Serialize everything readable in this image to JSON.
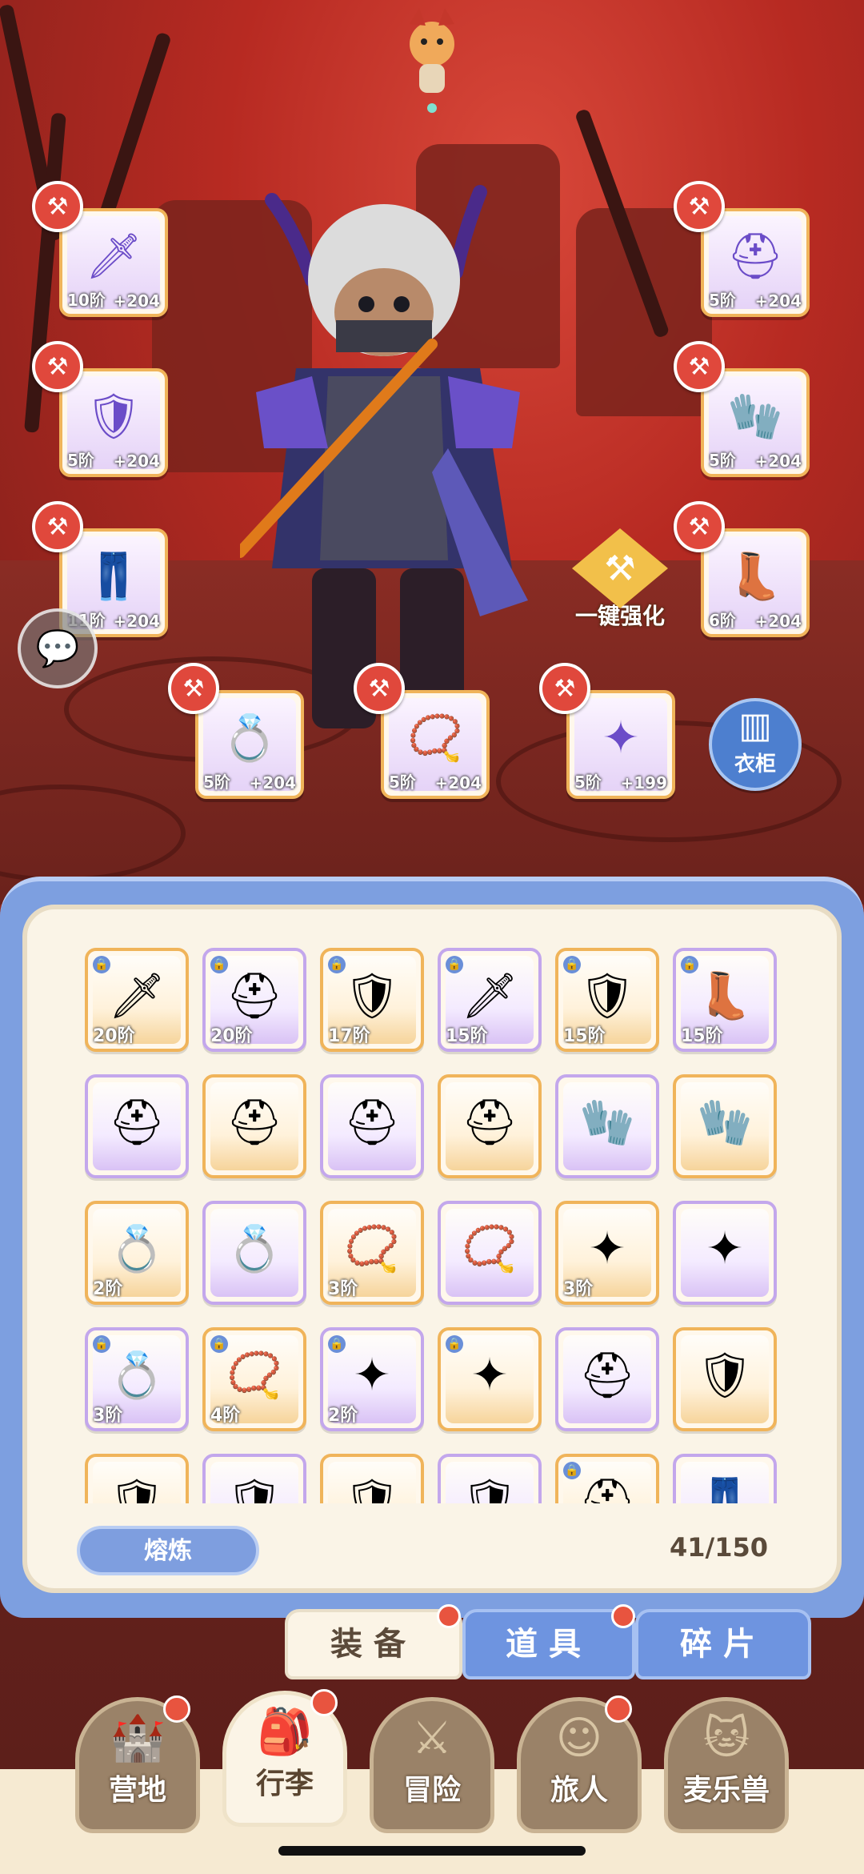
{
  "equipped": {
    "weapon": {
      "tier": "10阶",
      "bonus": "+204",
      "icon": "sword-icon"
    },
    "helmet": {
      "tier": "5阶",
      "bonus": "+204",
      "icon": "helmet-icon"
    },
    "armor": {
      "tier": "5阶",
      "bonus": "+204",
      "icon": "armor-icon"
    },
    "gloves": {
      "tier": "5阶",
      "bonus": "+204",
      "icon": "gloves-icon"
    },
    "pants": {
      "tier": "11阶",
      "bonus": "+204",
      "icon": "pants-icon"
    },
    "boots": {
      "tier": "6阶",
      "bonus": "+204",
      "icon": "boots-icon"
    },
    "ring": {
      "tier": "5阶",
      "bonus": "+204",
      "icon": "ring-icon"
    },
    "necklace": {
      "tier": "5阶",
      "bonus": "+204",
      "icon": "necklace-icon"
    },
    "charm": {
      "tier": "5阶",
      "bonus": "+199",
      "icon": "charm-icon"
    }
  },
  "actions": {
    "one_key_enhance": "一键强化",
    "wardrobe": "衣柜"
  },
  "inventory": {
    "rows": [
      [
        {
          "tier": "20阶",
          "icon": "sword-icon",
          "locked": true
        },
        {
          "tier": "20阶",
          "icon": "helmet-icon",
          "locked": true
        },
        {
          "tier": "17阶",
          "icon": "armor-icon",
          "locked": true
        },
        {
          "tier": "15阶",
          "icon": "sword-icon",
          "locked": true
        },
        {
          "tier": "15阶",
          "icon": "armor-icon",
          "locked": true
        },
        {
          "tier": "15阶",
          "icon": "boots-icon",
          "locked": true
        }
      ],
      [
        {
          "tier": "",
          "icon": "helmet-icon",
          "locked": false
        },
        {
          "tier": "",
          "icon": "helmet-icon",
          "locked": false
        },
        {
          "tier": "",
          "icon": "helmet-icon",
          "locked": false
        },
        {
          "tier": "",
          "icon": "helmet-icon",
          "locked": false
        },
        {
          "tier": "",
          "icon": "gloves-icon",
          "locked": false
        },
        {
          "tier": "",
          "icon": "gloves-icon",
          "locked": false
        }
      ],
      [
        {
          "tier": "2阶",
          "icon": "ring-icon",
          "locked": false
        },
        {
          "tier": "",
          "icon": "ring-icon",
          "locked": false
        },
        {
          "tier": "3阶",
          "icon": "necklace-icon",
          "locked": false
        },
        {
          "tier": "",
          "icon": "necklace-icon",
          "locked": false
        },
        {
          "tier": "3阶",
          "icon": "charm-icon",
          "locked": false
        },
        {
          "tier": "",
          "icon": "charm-icon",
          "locked": false
        }
      ],
      [
        {
          "tier": "3阶",
          "icon": "ring-icon",
          "locked": true
        },
        {
          "tier": "4阶",
          "icon": "necklace-icon",
          "locked": true
        },
        {
          "tier": "2阶",
          "icon": "charm-icon",
          "locked": true
        },
        {
          "tier": "",
          "icon": "charm-icon",
          "locked": true
        },
        {
          "tier": "",
          "icon": "helmet-icon",
          "locked": false
        },
        {
          "tier": "",
          "icon": "armor-icon",
          "locked": false
        }
      ],
      [
        {
          "tier": "",
          "icon": "armor-icon",
          "locked": false
        },
        {
          "tier": "",
          "icon": "armor-icon",
          "locked": false
        },
        {
          "tier": "",
          "icon": "armor-icon",
          "locked": false
        },
        {
          "tier": "",
          "icon": "armor-icon",
          "locked": false
        },
        {
          "tier": "",
          "icon": "helmet-icon",
          "locked": true
        },
        {
          "tier": "",
          "icon": "pants-icon",
          "locked": false
        }
      ]
    ],
    "smelt_label": "熔炼",
    "capacity": "41/150"
  },
  "tabs": [
    {
      "label": "装备",
      "active": true,
      "dot": true
    },
    {
      "label": "道具",
      "active": false,
      "dot": true
    },
    {
      "label": "碎片",
      "active": false,
      "dot": false
    }
  ],
  "bottom_nav": [
    {
      "label": "营地",
      "icon": "castle-icon",
      "active": false,
      "dot": true
    },
    {
      "label": "行李",
      "icon": "backpack-icon",
      "active": true,
      "dot": true
    },
    {
      "label": "冒险",
      "icon": "crossed-swords-icon",
      "active": false,
      "dot": false
    },
    {
      "label": "旅人",
      "icon": "character-icon",
      "active": false,
      "dot": true
    },
    {
      "label": "麦乐兽",
      "icon": "pet-icon",
      "active": false,
      "dot": false
    }
  ],
  "colors": {
    "accent_blue": "#7e9edf",
    "slot_gold": "#f0b45a",
    "slot_violet": "#c3a7ec",
    "alert_red": "#e8543f",
    "panel_bg": "#faf4e7"
  }
}
